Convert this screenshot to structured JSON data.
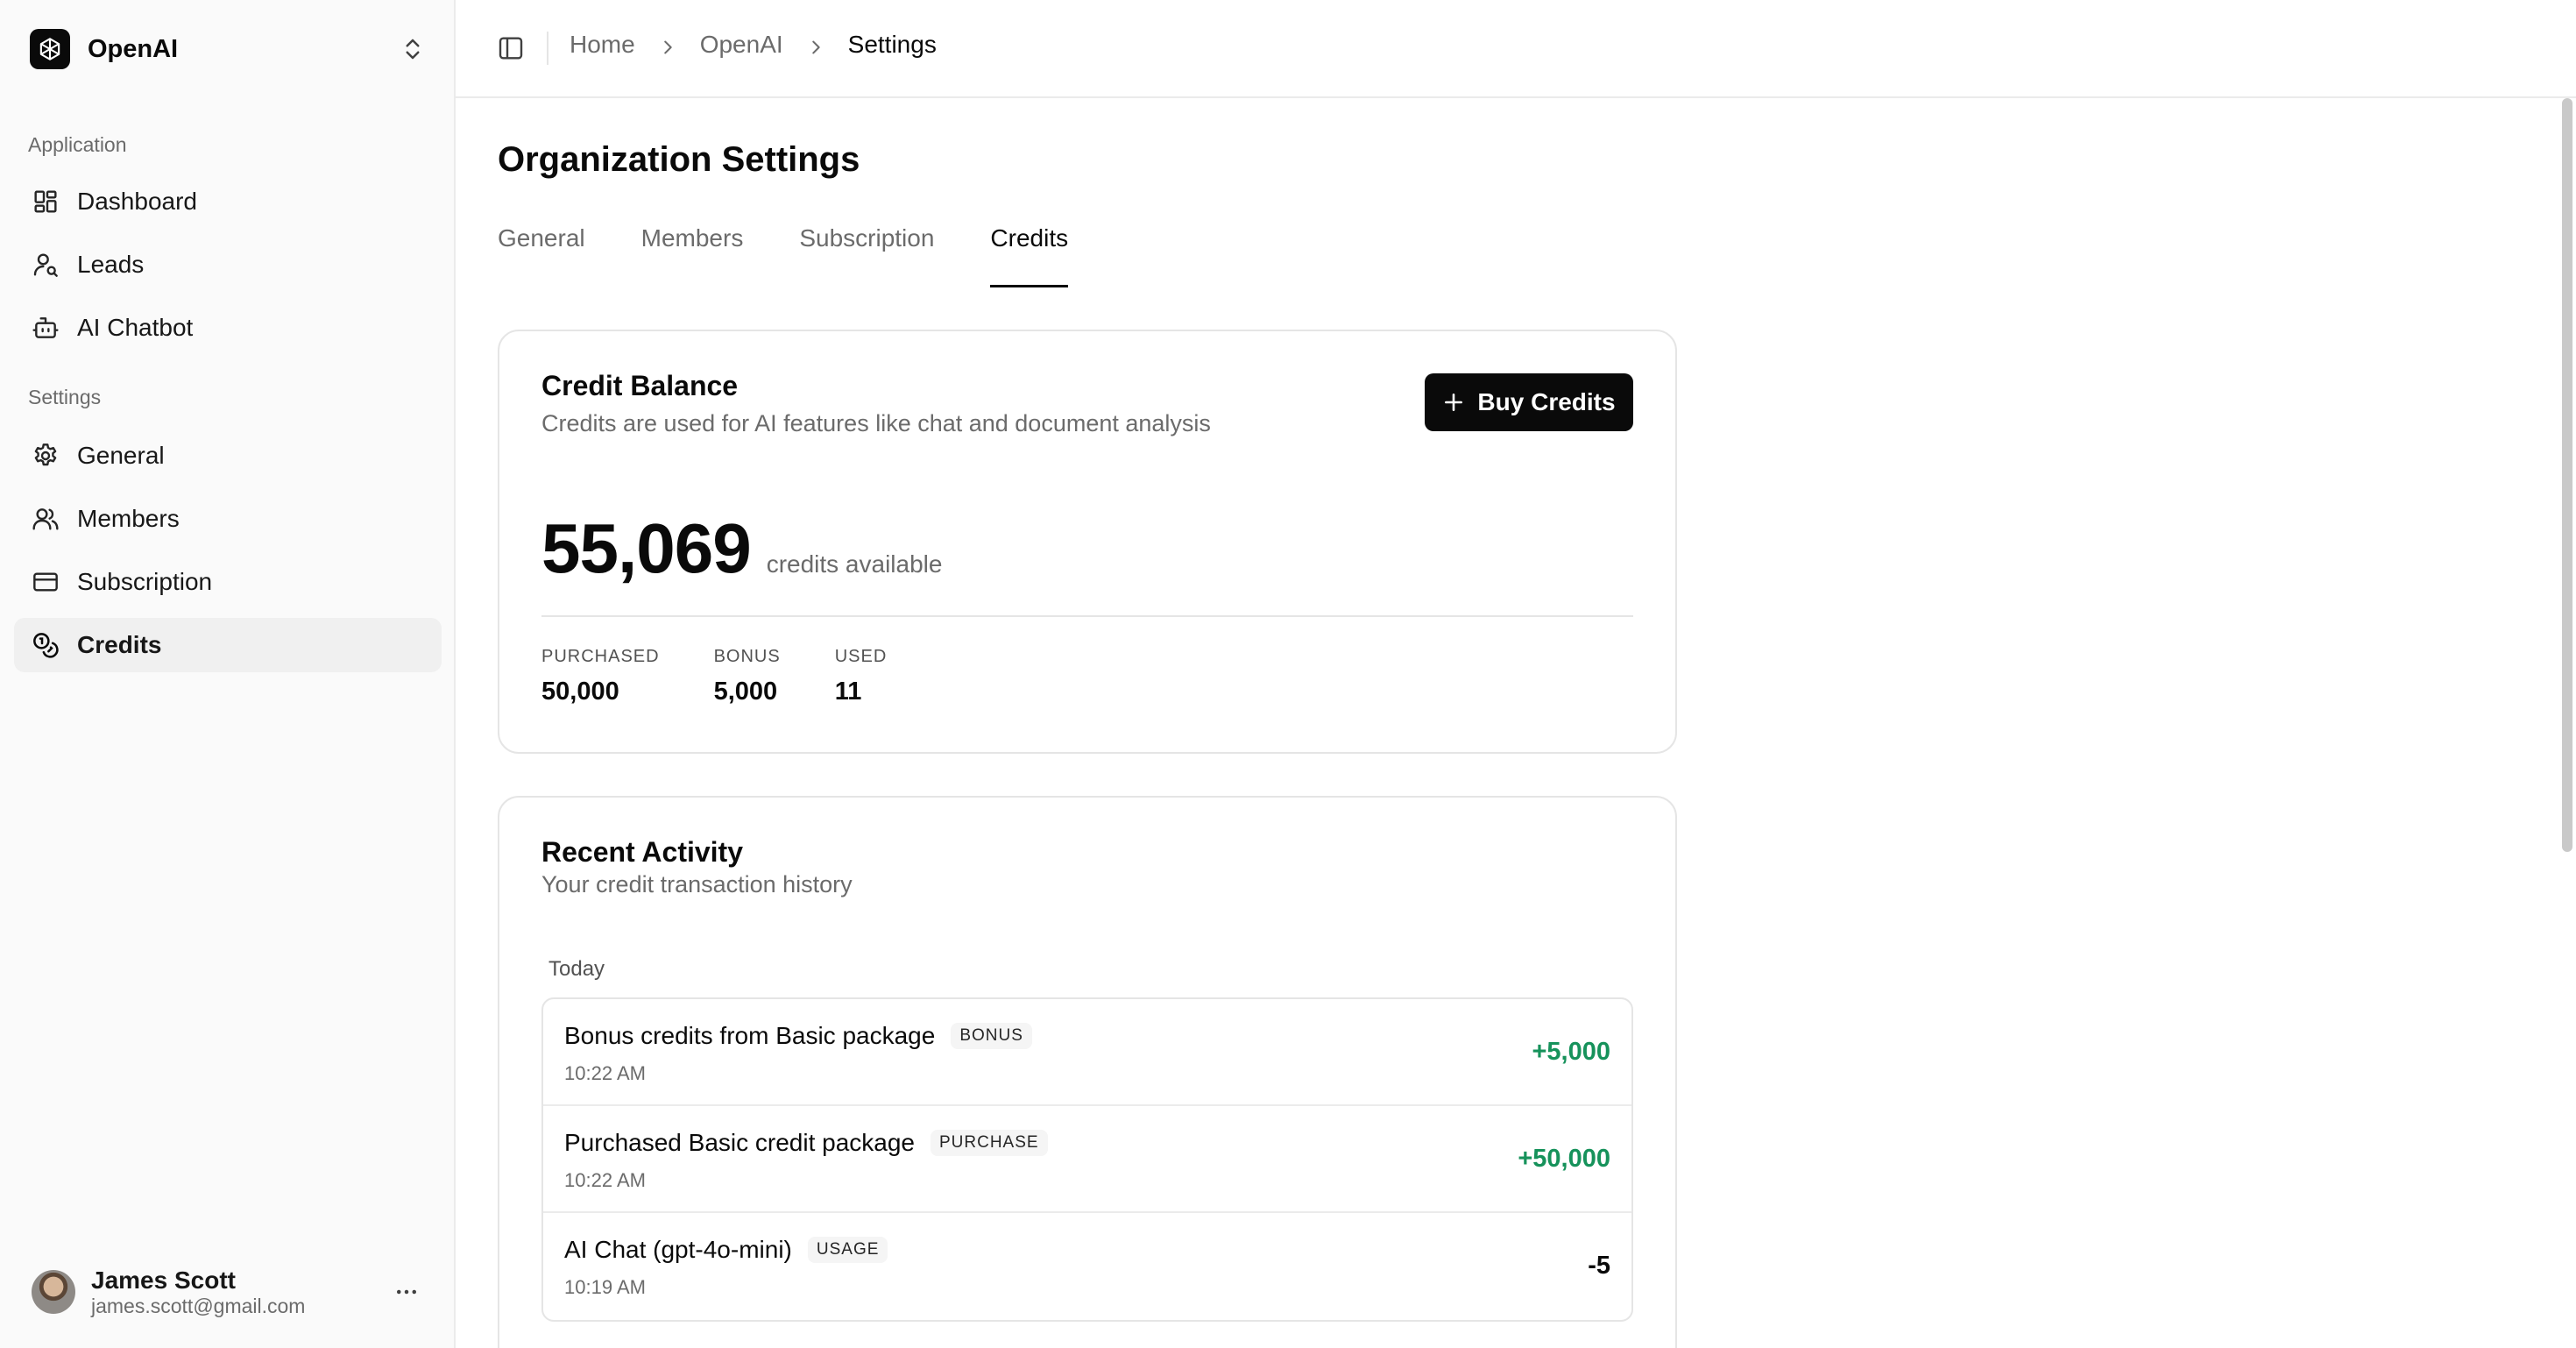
{
  "sidebar": {
    "org_name": "OpenAI",
    "groups": {
      "application": "Application",
      "settings": "Settings"
    },
    "items": {
      "dashboard": "Dashboard",
      "leads": "Leads",
      "ai_chatbot": "AI Chatbot",
      "general": "General",
      "members": "Members",
      "subscription": "Subscription",
      "credits": "Credits"
    },
    "active_item": "credits",
    "user": {
      "name": "James Scott",
      "email": "james.scott@gmail.com"
    }
  },
  "breadcrumb": {
    "items": [
      "Home",
      "OpenAI",
      "Settings"
    ]
  },
  "page": {
    "title": "Organization Settings",
    "tabs": [
      "General",
      "Members",
      "Subscription",
      "Credits"
    ],
    "active_tab": "Credits"
  },
  "balance_card": {
    "title": "Credit Balance",
    "subtitle": "Credits are used for AI features like chat and document analysis",
    "buy_label": "Buy Credits",
    "balance": "55,069",
    "balance_label": "credits available",
    "stats": [
      {
        "label": "PURCHASED",
        "value": "50,000"
      },
      {
        "label": "BONUS",
        "value": "5,000"
      },
      {
        "label": "USED",
        "value": "11"
      }
    ]
  },
  "activity_card": {
    "title": "Recent Activity",
    "subtitle": "Your credit transaction history",
    "day_label": "Today",
    "transactions": [
      {
        "description": "Bonus credits from Basic package",
        "badge": "BONUS",
        "time": "10:22 AM",
        "amount": "+5,000",
        "direction": "positive"
      },
      {
        "description": "Purchased Basic credit package",
        "badge": "PURCHASE",
        "time": "10:22 AM",
        "amount": "+50,000",
        "direction": "positive"
      },
      {
        "description": "AI Chat (gpt-4o-mini)",
        "badge": "USAGE",
        "time": "10:19 AM",
        "amount": "-5",
        "direction": "negative"
      }
    ]
  },
  "colors": {
    "accent": "#0a0a0a",
    "positive": "#16925b",
    "sidebar_bg": "#fafafa",
    "border": "#e5e5e5"
  },
  "icons": {
    "org_logo": "openai-logo-icon",
    "org_switch": "chevron-up-down-icon",
    "dashboard": "layout-grid-icon",
    "leads": "user-search-icon",
    "ai_chatbot": "bot-icon",
    "general": "gear-icon",
    "members": "users-icon",
    "subscription": "credit-card-icon",
    "credits": "coins-icon",
    "sidebar_toggle": "panel-left-icon",
    "more": "ellipsis-icon",
    "buy": "plus-icon"
  }
}
